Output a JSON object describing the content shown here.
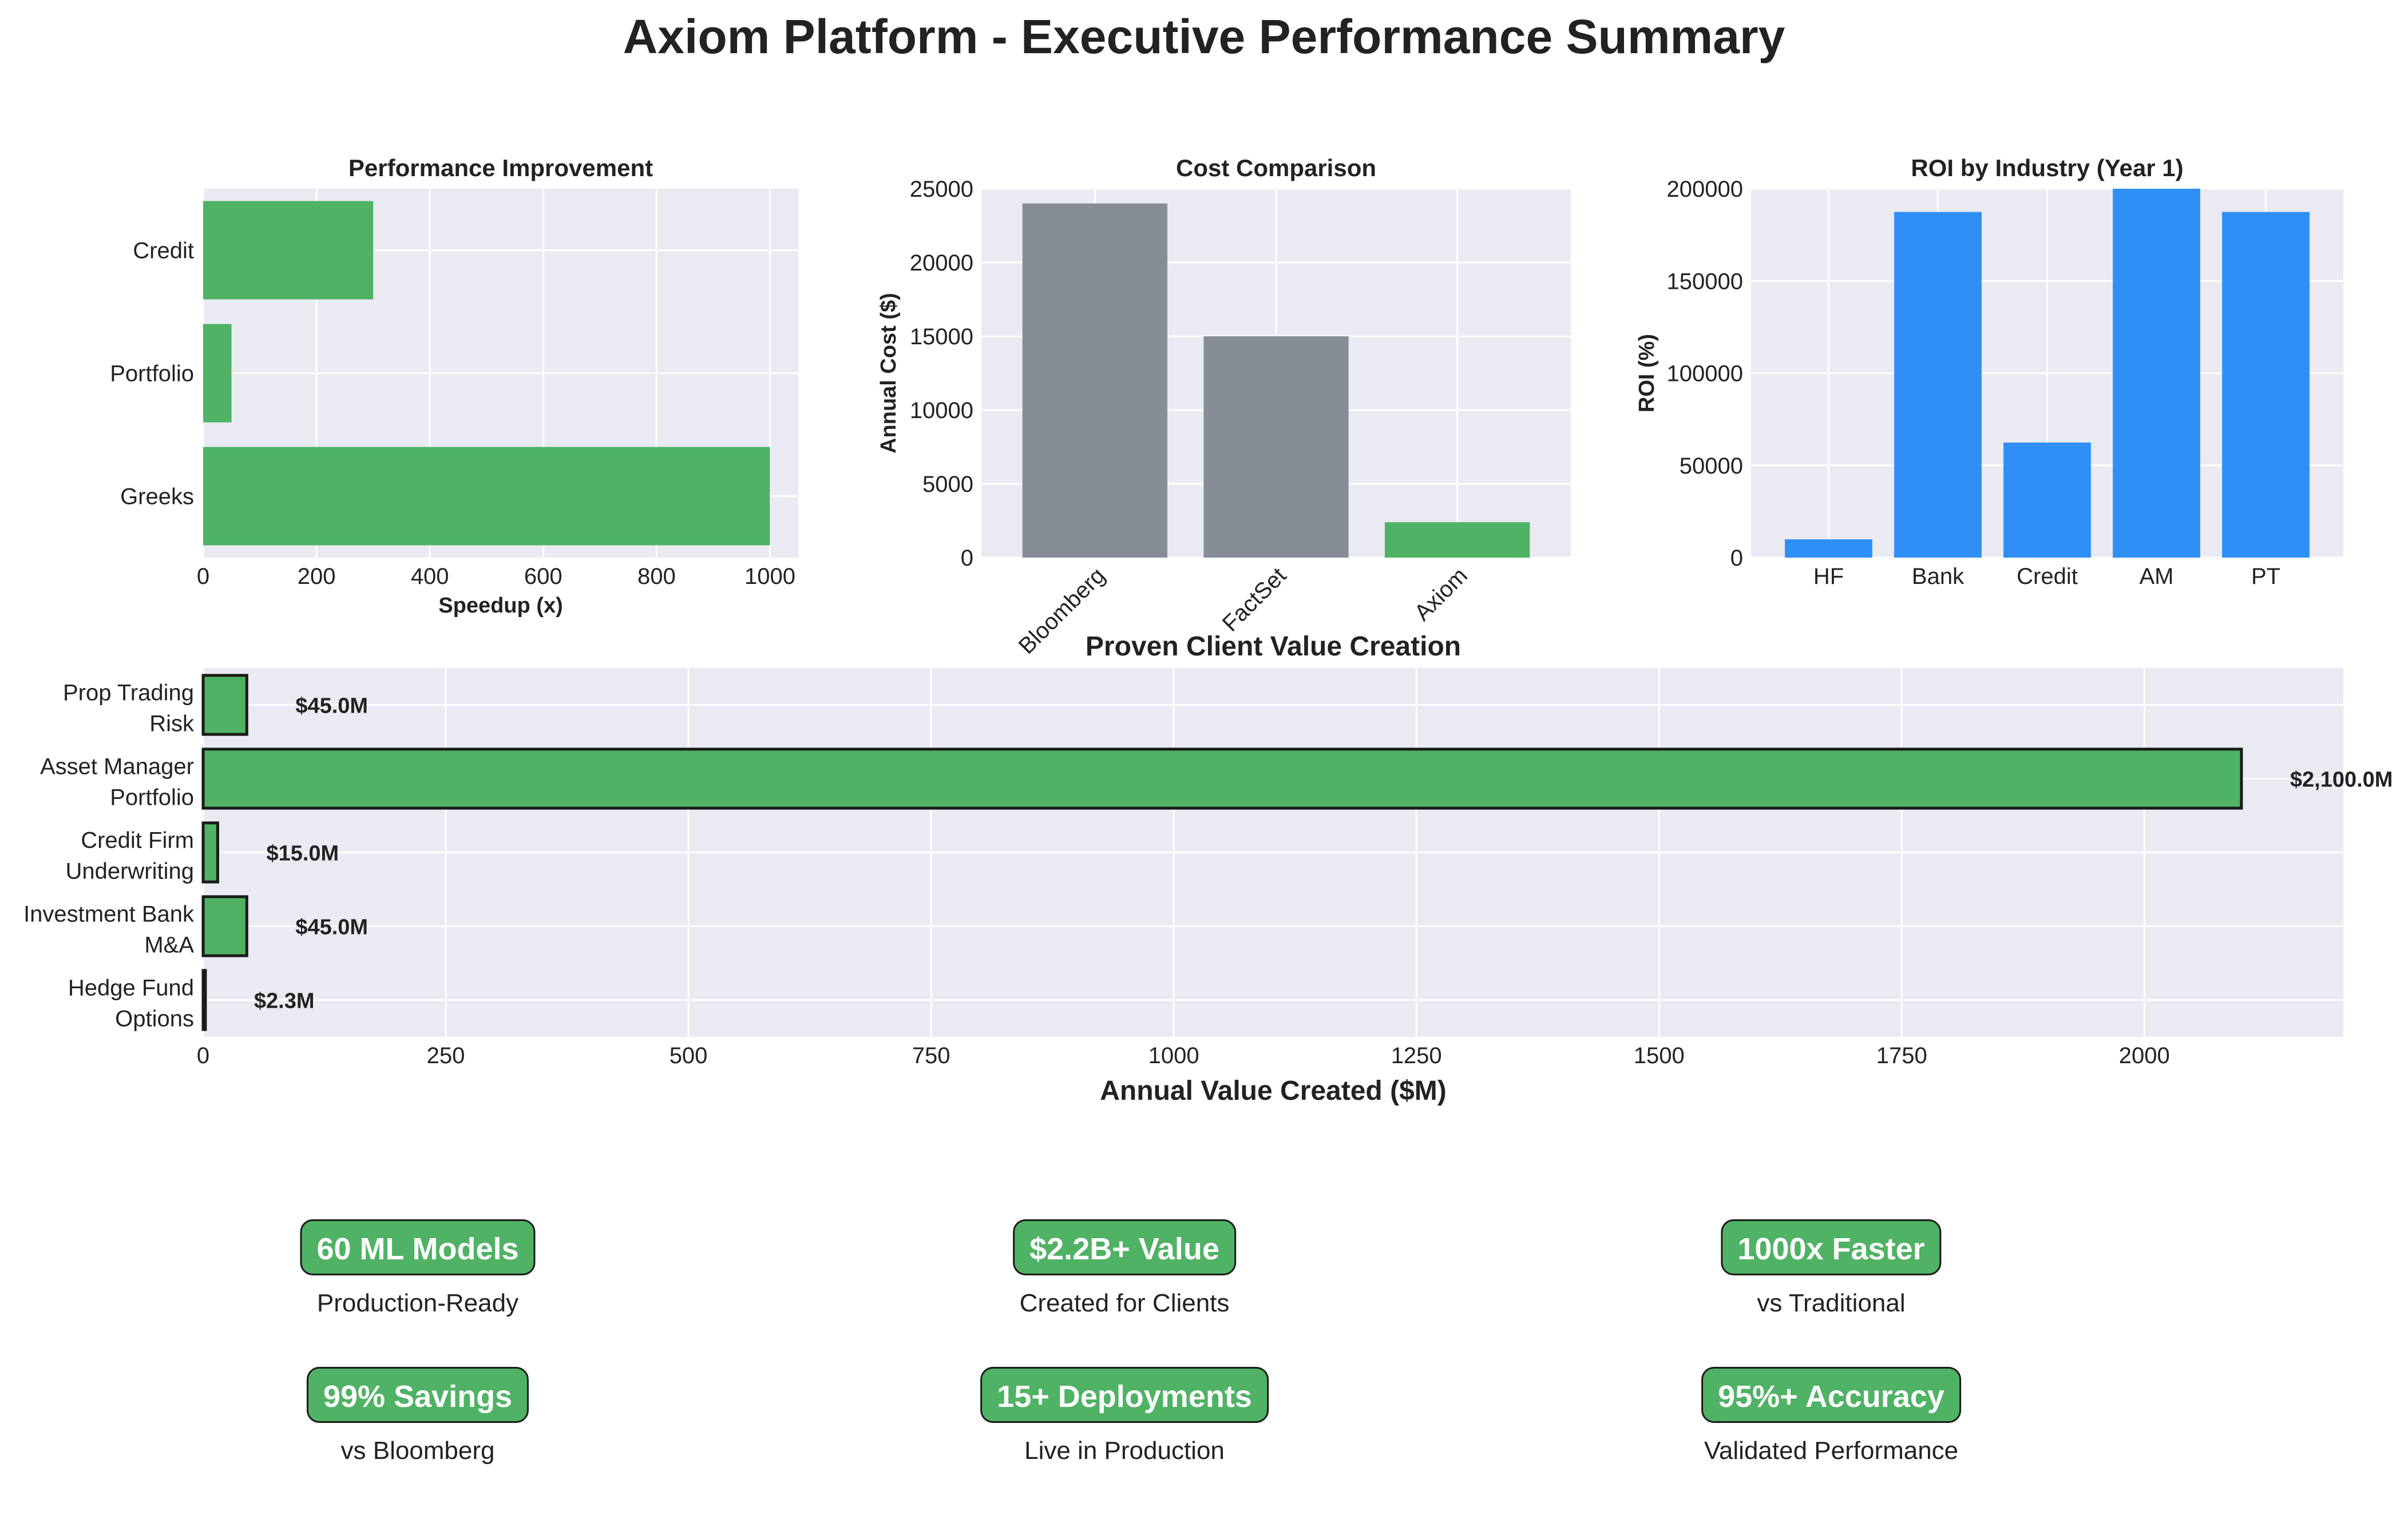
{
  "title": "Axiom Platform - Executive Performance Summary",
  "chart_data": [
    {
      "id": "performance",
      "type": "bar",
      "orientation": "horizontal",
      "title": "Performance Improvement",
      "xlabel": "Speedup (x)",
      "ylabel": "",
      "categories": [
        "Credit",
        "Portfolio",
        "Greeks"
      ],
      "values": [
        300,
        50,
        1000
      ],
      "xlim": [
        0,
        1050
      ],
      "xticks": [
        0,
        200,
        400,
        600,
        800,
        1000
      ],
      "color": "#4fb264",
      "grid": true
    },
    {
      "id": "cost",
      "type": "bar",
      "title": "Cost Comparison",
      "xlabel": "",
      "ylabel": "Annual Cost ($)",
      "categories": [
        "Bloomberg",
        "FactSet",
        "Axiom"
      ],
      "values": [
        24000,
        15000,
        2400
      ],
      "colors": [
        "#868d95",
        "#868d95",
        "#4fb264"
      ],
      "ylim": [
        0,
        25000
      ],
      "yticks": [
        0,
        5000,
        10000,
        15000,
        20000,
        25000
      ],
      "grid": true
    },
    {
      "id": "roi",
      "type": "bar",
      "title": "ROI by Industry (Year 1)",
      "xlabel": "",
      "ylabel": "ROI (%)",
      "categories": [
        "HF",
        "Bank",
        "Credit",
        "AM",
        "PT"
      ],
      "values": [
        9900,
        187400,
        62400,
        200000,
        187400
      ],
      "color": "#2f8ff5",
      "ylim": [
        0,
        200000
      ],
      "yticks": [
        0,
        50000,
        100000,
        150000,
        200000
      ],
      "grid": true
    },
    {
      "id": "value",
      "type": "bar",
      "orientation": "horizontal",
      "title": "Proven Client Value Creation",
      "xlabel": "Annual Value Created ($M)",
      "ylabel": "",
      "categories": [
        [
          "Prop Trading",
          "Risk"
        ],
        [
          "Asset Manager",
          "Portfolio"
        ],
        [
          "Credit Firm",
          "Underwriting"
        ],
        [
          "Investment Bank",
          "M&A"
        ],
        [
          "Hedge Fund",
          "Options"
        ]
      ],
      "values": [
        45,
        2100,
        15,
        45,
        2.3
      ],
      "value_labels": [
        "$45.0M",
        "$2,100.0M",
        "$15.0M",
        "$45.0M",
        "$2.3M"
      ],
      "xlim": [
        0,
        2205
      ],
      "xticks": [
        0,
        250,
        500,
        750,
        1000,
        1250,
        1500,
        1750,
        2000
      ],
      "color": "#4fb264",
      "edgecolor": "#1a1a1a",
      "grid": true
    }
  ],
  "kpis": [
    {
      "label": "60 ML Models",
      "sub": "Production-Ready"
    },
    {
      "label": "$2.2B+ Value",
      "sub": "Created for Clients"
    },
    {
      "label": "1000x Faster",
      "sub": "vs Traditional"
    },
    {
      "label": "99% Savings",
      "sub": "vs Bloomberg"
    },
    {
      "label": "15+ Deployments",
      "sub": "Live in Production"
    },
    {
      "label": "95%+ Accuracy",
      "sub": "Validated Performance"
    }
  ]
}
